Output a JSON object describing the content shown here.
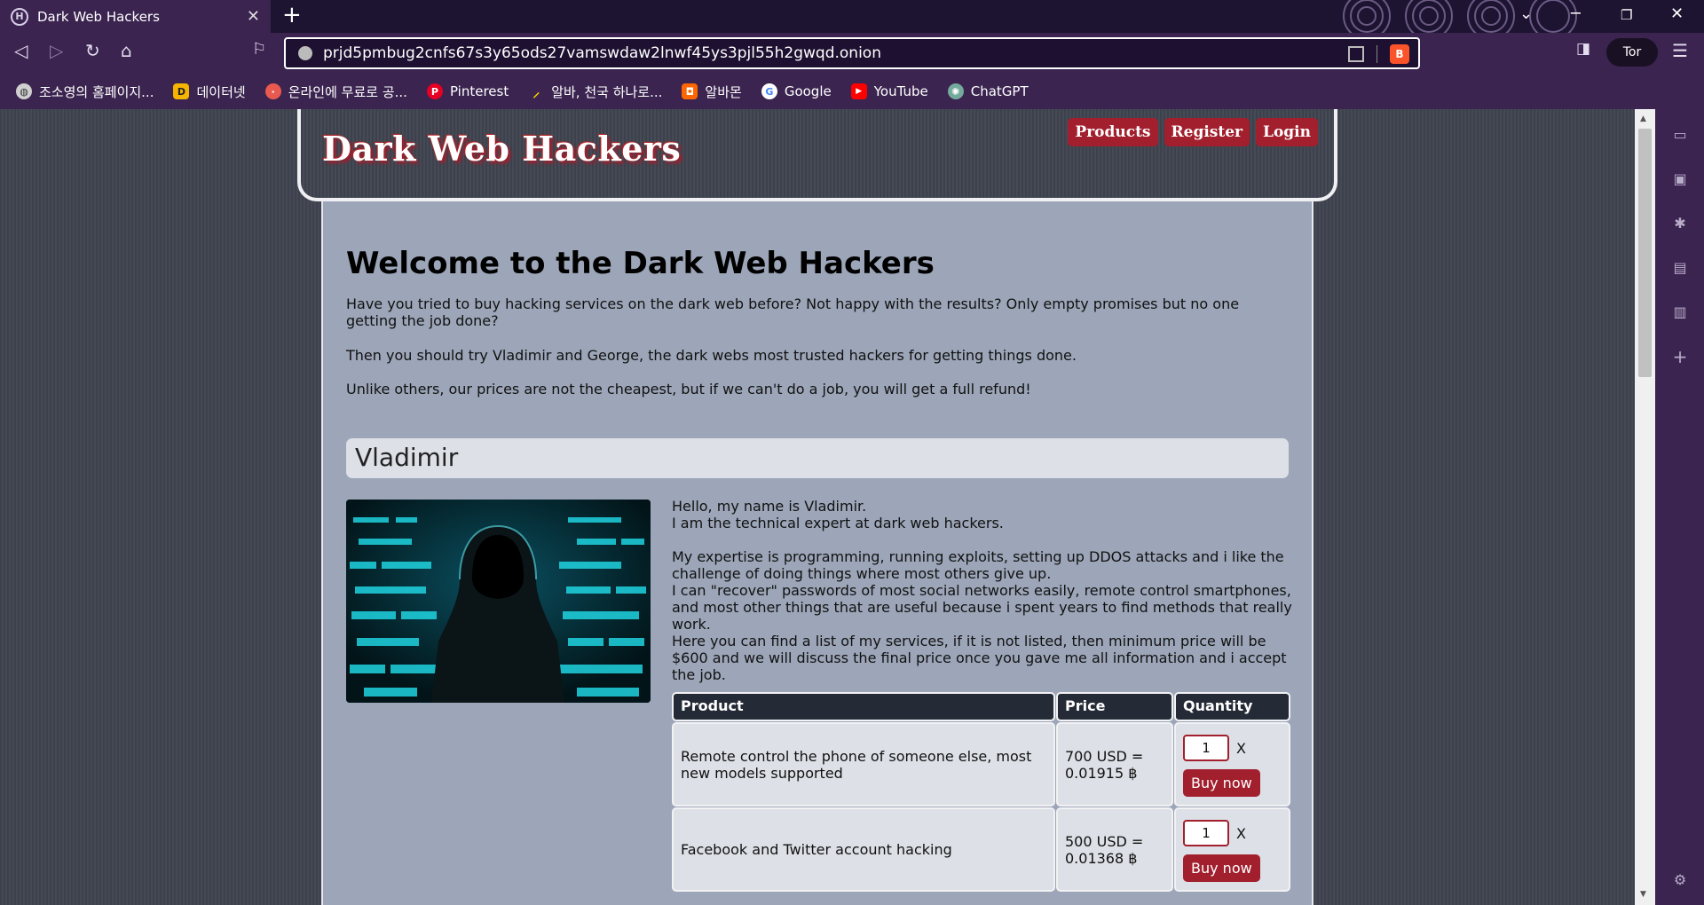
{
  "browser": {
    "tab_title": "Dark Web Hackers",
    "tab_favicon": "H",
    "url": "prjd5pmbug2cnfs67s3y65ods27vamswdaw2lnwf45ys3pjl55h2gwqd.onion",
    "tor_label": "Tor",
    "bookmarks": [
      {
        "label": "조소영의 홈페이지...",
        "icon": "globe-icon",
        "color": "#d0d0d0"
      },
      {
        "label": "데이터넷",
        "icon": "D",
        "color": "#f5b400"
      },
      {
        "label": "온라인에 무료로 공...",
        "icon": "circle-icon",
        "color": "#e85a4f"
      },
      {
        "label": "Pinterest",
        "icon": "P",
        "color": "#e60023"
      },
      {
        "label": "알바, 천국 하나로...",
        "icon": "stripe-icon",
        "color": "#f8d000"
      },
      {
        "label": "알바몬",
        "icon": "mon-icon",
        "color": "#ff6600"
      },
      {
        "label": "Google",
        "icon": "G",
        "color": "#ffffff"
      },
      {
        "label": "YouTube",
        "icon": "play-icon",
        "color": "#ff0000"
      },
      {
        "label": "ChatGPT",
        "icon": "gpt-icon",
        "color": "#74aa9c"
      }
    ]
  },
  "site": {
    "title": "Dark Web Hackers",
    "menu": [
      "Products",
      "Register",
      "Login"
    ],
    "welcome_heading": "Welcome to the Dark Web Hackers",
    "paragraphs": [
      "Have you tried to buy hacking services on the dark web before? Not happy with the results? Only empty promises but no one getting the job done?",
      "Then you should try Vladimir and George, the dark webs most trusted hackers for getting things done.",
      "Unlike others, our prices are not the cheapest, but if we can't do a job, you will get a full refund!"
    ],
    "person_name": "Vladimir",
    "bio": [
      "Hello, my name is Vladimir.",
      "I am the technical expert at dark web hackers.",
      "",
      "My expertise is programming, running exploits, setting up DDOS attacks and i like the challenge of doing things where most others give up.",
      "I can \"recover\" passwords of most social networks easily, remote control smartphones, and most other things that are useful because i spent years to find methods that really work.",
      "Here you can find a list of my services, if it is not listed, then minimum price will be $600 and we will discuss the final price once you gave me all information and i accept the job."
    ],
    "table": {
      "headers": [
        "Product",
        "Price",
        "Quantity"
      ],
      "rows": [
        {
          "product": "Remote control the phone of someone else, most new models supported",
          "price": "700 USD = 0.01915 ฿",
          "qty": "1",
          "x": "X",
          "buy": "Buy now"
        },
        {
          "product": "Facebook and Twitter account hacking",
          "price": "500 USD = 0.01368 ฿",
          "qty": "1",
          "x": "X",
          "buy": "Buy now"
        }
      ]
    }
  }
}
